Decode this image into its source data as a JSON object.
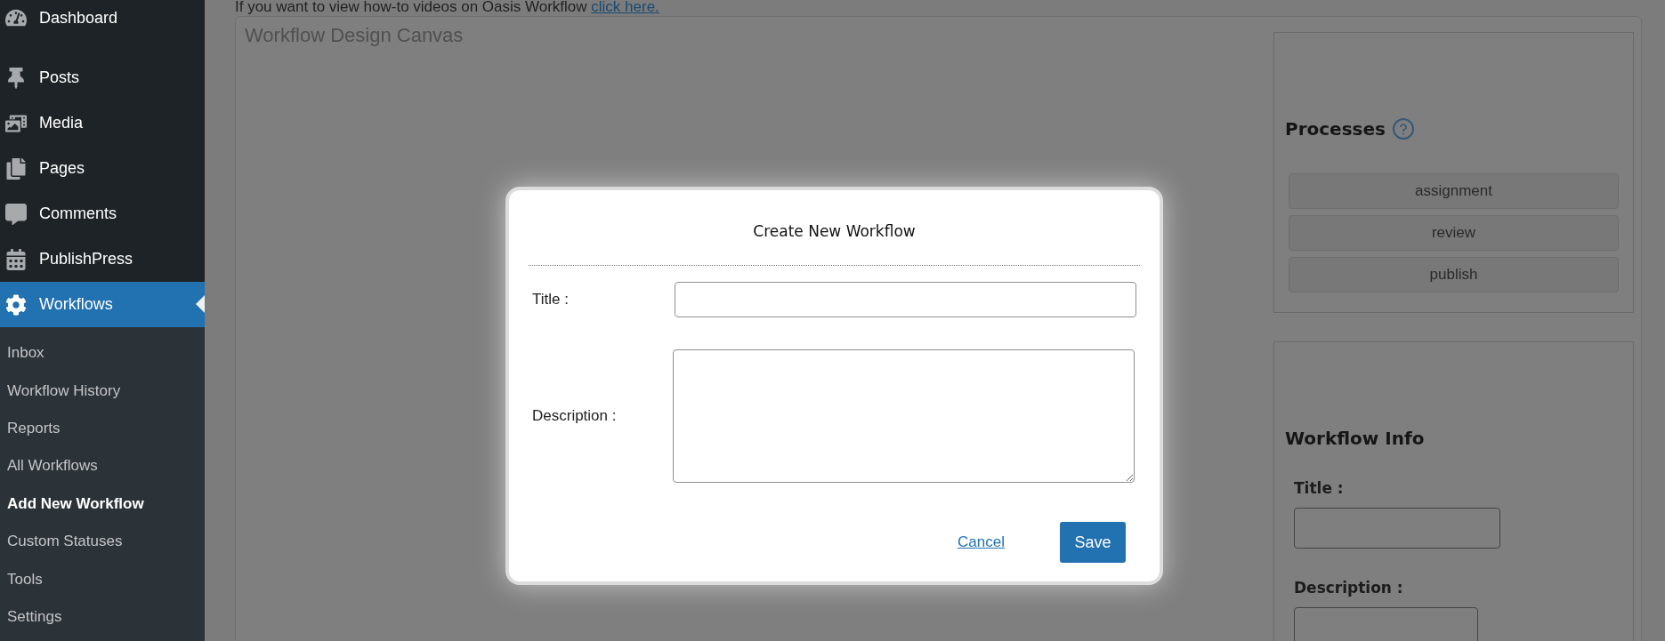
{
  "sidebar": {
    "menu": [
      {
        "label": "Dashboard",
        "selected": false
      },
      {
        "label": "Posts",
        "selected": false
      },
      {
        "label": "Media",
        "selected": false
      },
      {
        "label": "Pages",
        "selected": false
      },
      {
        "label": "Comments",
        "selected": false
      },
      {
        "label": "PublishPress",
        "selected": false
      },
      {
        "label": "Workflows",
        "selected": true
      }
    ],
    "submenu": [
      {
        "label": "Inbox",
        "selected": false
      },
      {
        "label": "Workflow History",
        "selected": false
      },
      {
        "label": "Reports",
        "selected": false
      },
      {
        "label": "All Workflows",
        "selected": false
      },
      {
        "label": "Add New Workflow",
        "selected": true
      },
      {
        "label": "Custom Statuses",
        "selected": false
      },
      {
        "label": "Tools",
        "selected": false
      },
      {
        "label": "Settings",
        "selected": false
      }
    ]
  },
  "notice": {
    "text": "If you want to view how-to videos on Oasis Workflow",
    "link": "click here."
  },
  "canvas": {
    "title": "Workflow Design Canvas"
  },
  "processes": {
    "title": "Processes",
    "items": [
      "assignment",
      "review",
      "publish"
    ]
  },
  "workflow_info": {
    "title": "Workflow Info",
    "fields": [
      {
        "label": "Title :"
      },
      {
        "label": "Description :"
      }
    ]
  },
  "dialog": {
    "title": "Create New Workflow",
    "fields": [
      {
        "label": "Title :",
        "kind": "input"
      },
      {
        "label": "Description :",
        "kind": "textarea"
      }
    ],
    "cancel": "Cancel",
    "save": "Save"
  }
}
